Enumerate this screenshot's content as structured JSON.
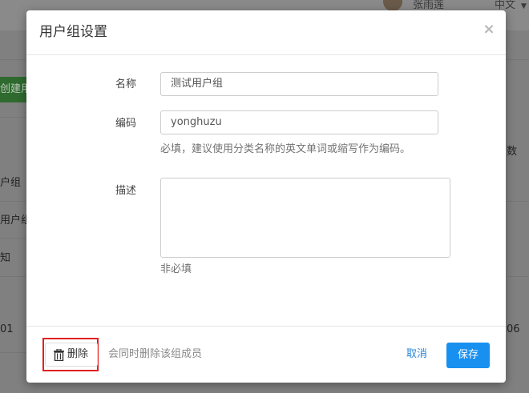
{
  "background": {
    "user_name": "张雨莲",
    "language": "中文",
    "create_button_label": "创建用",
    "rows": [
      "户组",
      "用户组",
      "知",
      "01"
    ],
    "right_cells": [
      "数",
      "06"
    ]
  },
  "modal": {
    "title": "用户组设置",
    "close_label": "×",
    "fields": {
      "name": {
        "label": "名称",
        "value": "测试用户组"
      },
      "code": {
        "label": "编码",
        "value": "yonghuzu",
        "help": "必填，建议使用分类名称的英文单词或缩写作为编码。"
      },
      "description": {
        "label": "描述",
        "value": "",
        "help": "非必填"
      }
    },
    "footer": {
      "delete_label": "删除",
      "delete_note": "会同时删除该组成员",
      "cancel_label": "取消",
      "save_label": "保存"
    }
  },
  "colors": {
    "primary": "#1890f0",
    "link": "#2a86d6",
    "highlight": "#e02020"
  },
  "icons": {
    "close": "close-icon",
    "delete": "trash-icon"
  }
}
